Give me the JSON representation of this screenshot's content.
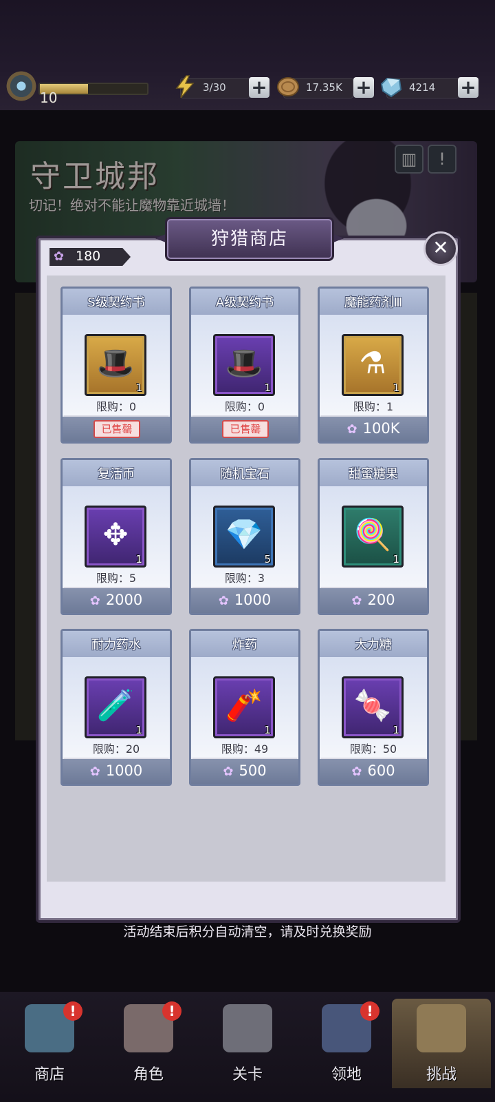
{
  "topbar": {
    "level": "10",
    "xp_fraction": 0.45,
    "energy": "3/30",
    "coins": "17.35K",
    "gems": "4214",
    "plus_label": "+"
  },
  "event": {
    "title": "守卫城邦",
    "subtitle": "切记！绝对不能让魔物靠近城墙！",
    "rank_icon": "podium-icon",
    "info_icon": "exclamation-icon"
  },
  "shop": {
    "title": "狩猎商店",
    "close_label": "✕",
    "points": "180",
    "currency_icon": "flower-icon",
    "items": [
      {
        "name": "S级契约书",
        "qty": "1",
        "limit": "限购：0",
        "sold_out": true,
        "sold_label": "已售罄",
        "price": "",
        "icon": "s-witch-hat-icon",
        "glyph": "🎩",
        "frame": "gold"
      },
      {
        "name": "A级契约书",
        "qty": "1",
        "limit": "限购：0",
        "sold_out": true,
        "sold_label": "已售罄",
        "price": "",
        "icon": "a-witch-hat-icon",
        "glyph": "🎩",
        "frame": "purple"
      },
      {
        "name": "魔能药剂Ⅲ",
        "qty": "1",
        "limit": "限购：1",
        "sold_out": false,
        "sold_label": "",
        "price": "100K",
        "icon": "potion-bottle-icon",
        "glyph": "⚗",
        "frame": "gold"
      },
      {
        "name": "复活币",
        "qty": "1",
        "limit": "限购：5",
        "sold_out": false,
        "sold_label": "",
        "price": "2000",
        "icon": "revive-coin-icon",
        "glyph": "✥",
        "frame": "purple"
      },
      {
        "name": "随机宝石",
        "qty": "5",
        "limit": "限购：3",
        "sold_out": false,
        "sold_label": "",
        "price": "1000",
        "icon": "gem-bag-icon",
        "glyph": "💎",
        "frame": "blue"
      },
      {
        "name": "甜蜜糖果",
        "qty": "1",
        "limit": "",
        "sold_out": false,
        "sold_label": "",
        "price": "200",
        "icon": "lollipop-icon",
        "glyph": "🍭",
        "frame": "teal"
      },
      {
        "name": "耐力药水",
        "qty": "1",
        "limit": "限购：20",
        "sold_out": false,
        "sold_label": "",
        "price": "1000",
        "icon": "stamina-potion-icon",
        "glyph": "🧪",
        "frame": "purple"
      },
      {
        "name": "炸药",
        "qty": "1",
        "limit": "限购：49",
        "sold_out": false,
        "sold_label": "",
        "price": "500",
        "icon": "dynamite-icon",
        "glyph": "🧨",
        "frame": "purple"
      },
      {
        "name": "大力糖",
        "qty": "1",
        "limit": "限购：50",
        "sold_out": false,
        "sold_label": "",
        "price": "600",
        "icon": "candy-icon",
        "glyph": "🍬",
        "frame": "purple"
      }
    ],
    "footer_note": "活动结束后积分自动清空，请及时兑换奖励"
  },
  "nav": [
    {
      "label": "商店",
      "icon": "shop-stall-icon",
      "badge": "!"
    },
    {
      "label": "角色",
      "icon": "character-icon",
      "badge": "!"
    },
    {
      "label": "关卡",
      "icon": "crossed-swords-icon",
      "badge": ""
    },
    {
      "label": "领地",
      "icon": "castle-icon",
      "badge": "!"
    },
    {
      "label": "挑战",
      "icon": "scroll-map-icon",
      "badge": ""
    }
  ],
  "colors": {
    "accent_purple": "#6b5a86",
    "sold_out_red": "#e04545",
    "card_border": "#6f7d9e"
  }
}
